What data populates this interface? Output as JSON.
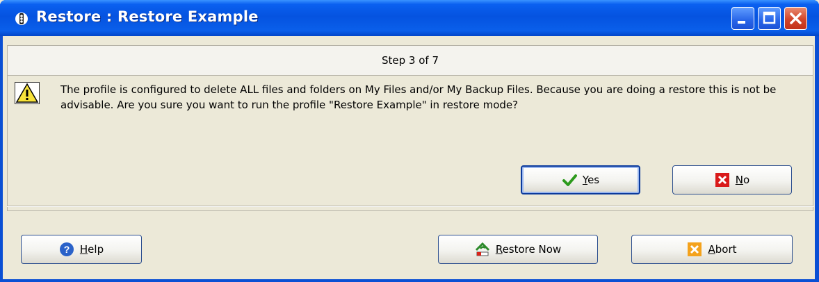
{
  "window": {
    "title": "Restore : Restore Example",
    "controls": [
      "minimize-icon",
      "maximize-icon",
      "close-icon"
    ]
  },
  "step": {
    "text": "Step 3 of 7"
  },
  "message": {
    "icon": "warning-icon",
    "text": "The profile is configured to delete ALL files and folders on My Files and/or My Backup Files. Because you are doing a restore this is not be advisable. Are you sure you want to run the profile \"Restore Example\" in restore mode?"
  },
  "prompt_buttons": {
    "yes": {
      "mnemonic": "Y",
      "rest": "es",
      "icon": "checkmark-icon"
    },
    "no": {
      "mnemonic": "N",
      "rest": "o",
      "icon": "red-x-icon"
    }
  },
  "footer_buttons": {
    "help": {
      "mnemonic": "H",
      "rest": "elp",
      "icon": "help-icon"
    },
    "restore_now": {
      "mnemonic": "R",
      "rest": "estore Now",
      "icon": "restore-icon"
    },
    "abort": {
      "mnemonic": "A",
      "rest": "bort",
      "icon": "abort-icon"
    }
  },
  "colors": {
    "titlebar": "#0553e0",
    "client": "#ece9d8",
    "accent_border": "#0b3a9c"
  }
}
